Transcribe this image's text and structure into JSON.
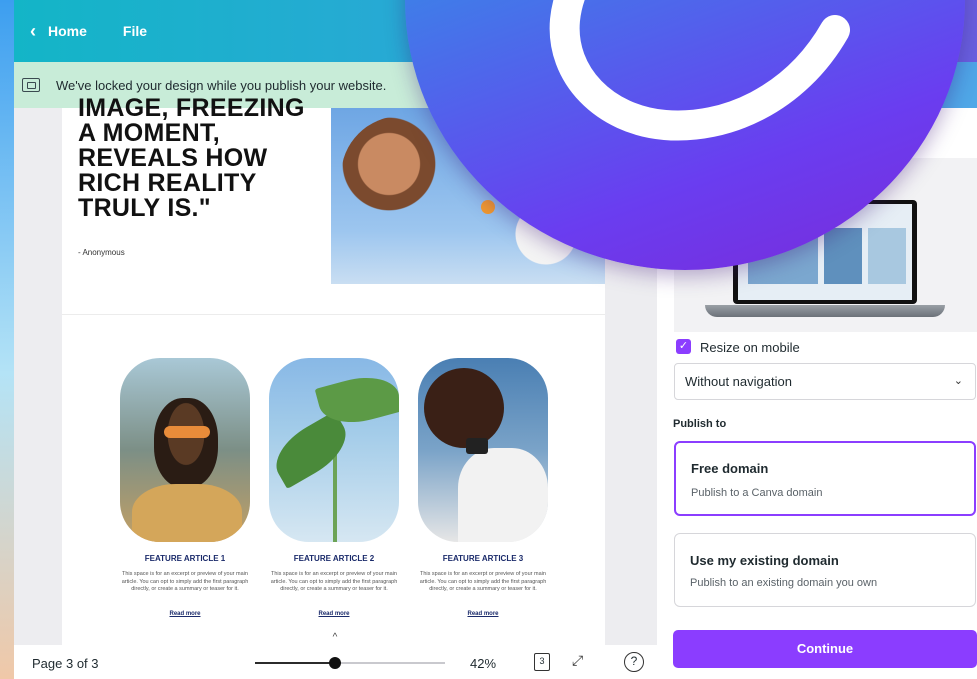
{
  "topbar": {
    "back_label": "Home",
    "file_label": "File"
  },
  "lock_banner": {
    "text": "We've locked your design while you publish your website."
  },
  "design": {
    "quote_text": "IMAGE, FREEZING A MOMENT, REVEALS HOW RICH REALITY TRULY IS.\"",
    "attribution": "- Anonymous",
    "articles": [
      {
        "title": "FEATURE ARTICLE 1",
        "body": "This space is for an excerpt or preview of your main article. You can opt to simply add the first paragraph directly, or create a summary or teaser for it.",
        "link": "Read more"
      },
      {
        "title": "FEATURE ARTICLE 2",
        "body": "This space is for an excerpt or preview of your main article. You can opt to simply add the first paragraph directly, or create a summary or teaser for it.",
        "link": "Read more"
      },
      {
        "title": "FEATURE ARTICLE 3",
        "body": "This space is for an excerpt or preview of your main article. You can opt to simply add the first paragraph directly, or create a summary or teaser for it.",
        "link": "Read more"
      }
    ]
  },
  "bottombar": {
    "page_indicator": "Page 3 of 3",
    "zoom_value": "42%",
    "zoom_fraction": 0.42,
    "pages_count": "3",
    "help_symbol": "?"
  },
  "panel": {
    "resize_label": "Resize on mobile",
    "resize_checked": true,
    "navigation_select": "Without navigation",
    "publish_heading": "Publish to",
    "domains": [
      {
        "title": "Free domain",
        "subtitle": "Publish to a Canva domain",
        "selected": true
      },
      {
        "title": "Use my existing domain",
        "subtitle": "Publish to an existing domain you own",
        "selected": false
      }
    ],
    "continue_label": "Continue"
  },
  "colors": {
    "accent": "#8b3dff",
    "banner": "#c8ecd8",
    "topbar_start": "#13b5c7",
    "topbar_end": "#6a5fe0"
  }
}
